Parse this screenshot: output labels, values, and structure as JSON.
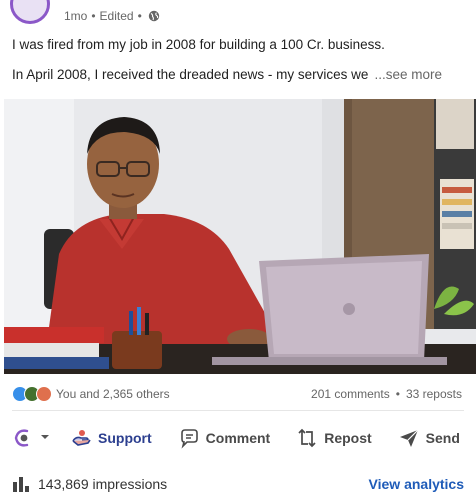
{
  "post": {
    "meta": {
      "time": "1mo",
      "separator1": "•",
      "edited": "Edited",
      "separator2": "•"
    },
    "text_line1": "I was fired from my job in 2008 for building a 100 Cr. business.",
    "text_line2": "In April 2008, I received the dreaded news - my services we",
    "see_more": "...see more"
  },
  "social": {
    "reactions_text": "You and 2,365 others",
    "comments": "201 comments",
    "dot": "•",
    "reposts": "33 reposts",
    "reaction_colors": [
      "#378fe9",
      "#44712e",
      "#df704d"
    ]
  },
  "actions": {
    "support": "Support",
    "comment": "Comment",
    "repost": "Repost",
    "send": "Send"
  },
  "footer": {
    "impressions": "143,869 impressions",
    "view_analytics": "View analytics"
  },
  "colors": {
    "accent_link": "#1e5bb8",
    "support_blue": "#2c3f8f",
    "avatar_ring": "#8b58c8"
  }
}
